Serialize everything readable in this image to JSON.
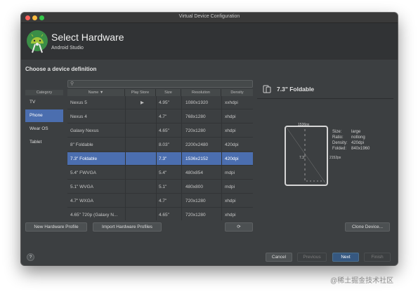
{
  "window": {
    "title": "Virtual Device Configuration"
  },
  "header": {
    "title": "Select Hardware",
    "subtitle": "Android Studio"
  },
  "section_title": "Choose a device definition",
  "category": {
    "header": "Category",
    "items": [
      "TV",
      "Phone",
      "Wear OS",
      "Tablet"
    ],
    "selected": "Phone"
  },
  "search": {
    "placeholder": ""
  },
  "table": {
    "columns": {
      "name": "Name ▼",
      "play_store": "Play Store",
      "size": "Size",
      "resolution": "Resolution",
      "density": "Density"
    },
    "rows": [
      {
        "name": "Nexus 5",
        "play_store": "▶",
        "size": "4.95\"",
        "resolution": "1080x1920",
        "density": "xxhdpi"
      },
      {
        "name": "Nexus 4",
        "play_store": "",
        "size": "4.7\"",
        "resolution": "768x1280",
        "density": "xhdpi"
      },
      {
        "name": "Galaxy Nexus",
        "play_store": "",
        "size": "4.65\"",
        "resolution": "720x1280",
        "density": "xhdpi"
      },
      {
        "name": "8\" Foldable",
        "play_store": "",
        "size": "8.03\"",
        "resolution": "2200x2480",
        "density": "420dpi"
      },
      {
        "name": "7.3\" Foldable",
        "play_store": "",
        "size": "7.3\"",
        "resolution": "1536x2152",
        "density": "420dpi"
      },
      {
        "name": "5.4\" FWVGA",
        "play_store": "",
        "size": "5.4\"",
        "resolution": "480x854",
        "density": "mdpi"
      },
      {
        "name": "5.1\" WVGA",
        "play_store": "",
        "size": "5.1\"",
        "resolution": "480x800",
        "density": "mdpi"
      },
      {
        "name": "4.7\" WXGA",
        "play_store": "",
        "size": "4.7\"",
        "resolution": "720x1280",
        "density": "xhdpi"
      },
      {
        "name": "4.65\" 720p (Galaxy N...",
        "play_store": "",
        "size": "4.65\"",
        "resolution": "720x1280",
        "density": "xhdpi"
      }
    ],
    "selected_row": "7.3\" Foldable"
  },
  "buttons": {
    "new_hardware_profile": "New Hardware Profile",
    "import_hardware_profiles": "Import Hardware Profiles",
    "refresh": "⟳",
    "clone_device": "Clone Device...",
    "cancel": "Cancel",
    "previous": "Previous",
    "next": "Next",
    "finish": "Finish",
    "help": "?"
  },
  "preview": {
    "title": "7.3\" Foldable",
    "width_label": "1536px",
    "height_label": "2152px",
    "diagonal_label": "7.3\"",
    "specs": [
      {
        "label": "Size:",
        "value": "large"
      },
      {
        "label": "Ratio:",
        "value": "notlong"
      },
      {
        "label": "Density:",
        "value": "420dpi"
      },
      {
        "label": "Folded:",
        "value": "840x1960"
      }
    ]
  },
  "colors": {
    "window_bg": "#3c3f41",
    "header_bg": "#313335",
    "selection": "#4b6eaf",
    "primary_button": "#365880",
    "android_green": "#a4c639"
  },
  "icons": [
    "android-studio-logo",
    "search-icon",
    "play-store-icon",
    "refresh-icon",
    "device-icon",
    "help-icon"
  ],
  "watermark": "@稀土掘金技术社区"
}
